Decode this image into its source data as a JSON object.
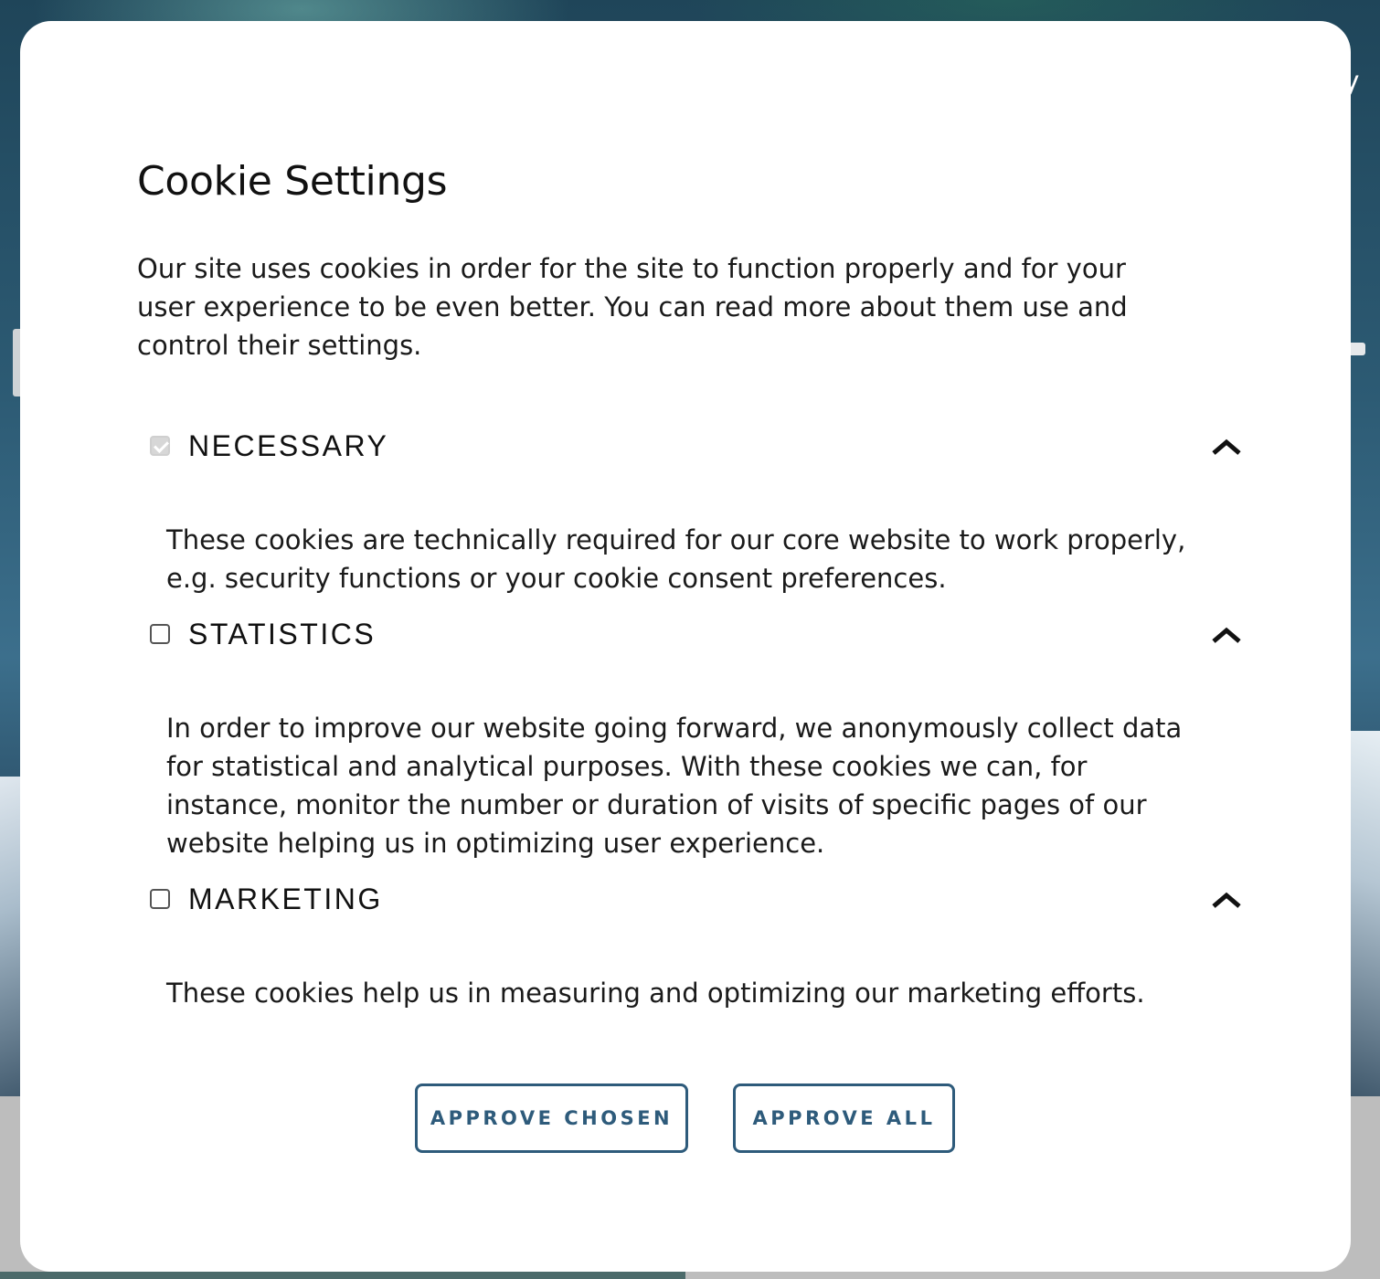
{
  "background": {
    "nav_text_fragment": "ty"
  },
  "modal": {
    "title": "Cookie Settings",
    "intro": "Our site uses cookies in order for the site to function properly and for your user experience to be even better. You can read more about them use and control their settings.",
    "categories": [
      {
        "label": "NECESSARY",
        "checked": true,
        "disabled": true,
        "expanded": true,
        "description": "These cookies are technically required for our core website to work properly, e.g. security functions or your cookie consent preferences."
      },
      {
        "label": "STATISTICS",
        "checked": false,
        "disabled": false,
        "expanded": true,
        "description": "In order to improve our website going forward, we anonymously collect data for statistical and analytical purposes. With these cookies we can, for instance, monitor the number or duration of visits of specific pages of our website helping us in optimizing user experience."
      },
      {
        "label": "MARKETING",
        "checked": false,
        "disabled": false,
        "expanded": true,
        "description": "These cookies help us in measuring and optimizing our marketing efforts."
      }
    ],
    "buttons": {
      "approve_chosen": "APPROVE CHOSEN",
      "approve_all": "APPROVE ALL"
    }
  },
  "colors": {
    "accent": "#2e5b7b",
    "text": "#111111",
    "modal_bg": "#ffffff"
  },
  "icons": {
    "expand_toggle": "chevron-up-icon"
  }
}
